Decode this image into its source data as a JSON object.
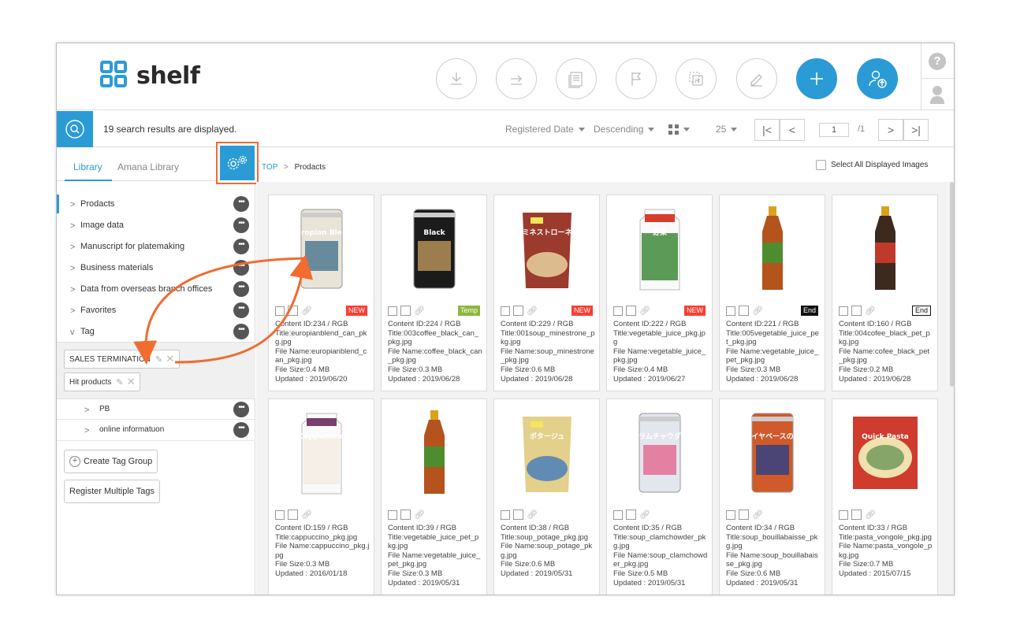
{
  "app": {
    "name": "shelf"
  },
  "search": {
    "results_text": "19 search results are displayed."
  },
  "toolbar": {
    "sort_field": "Registered Date",
    "sort_order": "Descending",
    "per_page": "25",
    "page_current": "1",
    "page_total": "/1"
  },
  "sidebar": {
    "tabs": [
      {
        "label": "Library"
      },
      {
        "label": "Amana Library"
      }
    ],
    "folders": [
      {
        "label": "Prodacts",
        "chevron": ">"
      },
      {
        "label": "Image data",
        "chevron": ">"
      },
      {
        "label": "Manuscript for platemaking",
        "chevron": ">"
      },
      {
        "label": "Business materials",
        "chevron": ">"
      },
      {
        "label": "Data from overseas branch offices",
        "chevron": ">"
      },
      {
        "label": "Favorites",
        "chevron": ">"
      },
      {
        "label": "Tag",
        "chevron": "v"
      }
    ],
    "tags": [
      {
        "label": "SALES TERMINATION"
      },
      {
        "label": "Hit products"
      }
    ],
    "tag_groups": [
      {
        "label": "PB"
      },
      {
        "label": "online informatuon"
      }
    ],
    "buttons": {
      "create_tag_group": "Create Tag Group",
      "register_multiple_tags": "Register Multiple Tags"
    },
    "more_glyph": "•••"
  },
  "breadcrumb": {
    "top": "TOP",
    "sep": ">",
    "current": "Prodacts"
  },
  "select_all_label": "Select All Displayed Images",
  "help_glyph": "?",
  "items": [
    {
      "badge": "NEW",
      "badge_type": "new",
      "id": "Content ID:234 / RGB",
      "title": "Title:europianblend_can_pkg.jpg",
      "file": "File Name:europianblend_can_pkg.jpg",
      "size": "File Size:0.4 MB",
      "updated": "Updated : 2019/06/20"
    },
    {
      "badge": "Temp",
      "badge_type": "temp",
      "id": "Content ID:224 / RGB",
      "title": "Title:003coffee_black_can_pkg.jpg",
      "file": "File Name:coffee_black_can_pkg.jpg",
      "size": "File Size:0.3 MB",
      "updated": "Updated : 2019/06/28"
    },
    {
      "badge": "NEW",
      "badge_type": "new",
      "id": "Content ID:229 / RGB",
      "title": "Title:001soup_minestrone_pkg.jpg",
      "file": "File Name:soup_minestrone_pkg.jpg",
      "size": "File Size:0.6 MB",
      "updated": "Updated : 2019/06/28"
    },
    {
      "badge": "NEW",
      "badge_type": "new",
      "id": "Content ID:222 / RGB",
      "title": "Title:vegetable_juice_pkg.jpg",
      "file": "File Name:vegetable_juice_pkg.jpg",
      "size": "File Size:0.4 MB",
      "updated": "Updated : 2019/06/27"
    },
    {
      "badge": "End",
      "badge_type": "endb",
      "id": "Content ID:221 / RGB",
      "title": "Title:005vegetable_juice_pet_pkg.jpg",
      "file": "File Name:vegetable_juice_pet_pkg.jpg",
      "size": "File Size:0.3 MB",
      "updated": "Updated : 2019/06/28"
    },
    {
      "badge": "End",
      "badge_type": "endw",
      "id": "Content ID:160 / RGB",
      "title": "Title:004cofee_black_pet_pkg.jpg",
      "file": "File Name:cofee_black_pet_pkg.jpg",
      "size": "File Size:0.2 MB",
      "updated": "Updated : 2019/06/28"
    },
    {
      "badge": "",
      "badge_type": "",
      "id": "Content ID:159 / RGB",
      "title": "Title:cappuccino_pkg.jpg",
      "file": "File Name:cappuccino_pkg.jpg",
      "size": "File Size:0.3 MB",
      "updated": "Updated : 2016/01/18"
    },
    {
      "badge": "",
      "badge_type": "",
      "id": "Content ID:39 / RGB",
      "title": "Title:vegetable_juice_pet_pkg.jpg",
      "file": "File Name:vegetable_juice_pet_pkg.jpg",
      "size": "File Size:0.3 MB",
      "updated": "Updated : 2019/05/31"
    },
    {
      "badge": "",
      "badge_type": "",
      "id": "Content ID:38 / RGB",
      "title": "Title:soup_potage_pkg.jpg",
      "file": "File Name:soup_potage_pkg.jpg",
      "size": "File Size:0.6 MB",
      "updated": "Updated : 2019/05/31"
    },
    {
      "badge": "",
      "badge_type": "",
      "id": "Content ID:35 / RGB",
      "title": "Title:soup_clamchowder_pkg.jpg",
      "file": "File Name:soup_clamchowder_pkg.jpg",
      "size": "File Size:0.5 MB",
      "updated": "Updated : 2019/05/31"
    },
    {
      "badge": "",
      "badge_type": "",
      "id": "Content ID:34 / RGB",
      "title": "Title:soup_bouillabaisse_pkg.jpg",
      "file": "File Name:soup_bouillabaisse_pkg.jpg",
      "size": "File Size:0.6 MB",
      "updated": "Updated : 2019/05/31"
    },
    {
      "badge": "",
      "badge_type": "",
      "id": "Content ID:33 / RGB",
      "title": "Title:pasta_vongole_pkg.jpg",
      "file": "File Name:pasta_vongole_pkg.jpg",
      "size": "File Size:0.7 MB",
      "updated": "Updated : 2015/07/15"
    }
  ],
  "thumbnail_labels": [
    "Europian Blend",
    "Black",
    "ミネストローネ",
    "野菜",
    "",
    "",
    "Cappuccino",
    "",
    "ポタージュ",
    "クラムチャウダー",
    "ブイヤベースの素",
    "Quick Pasta"
  ],
  "colors": {
    "accent": "#2b9bd6",
    "highlight": "#f26b2f",
    "new": "#ff3b30",
    "temp": "#8ab83a"
  }
}
